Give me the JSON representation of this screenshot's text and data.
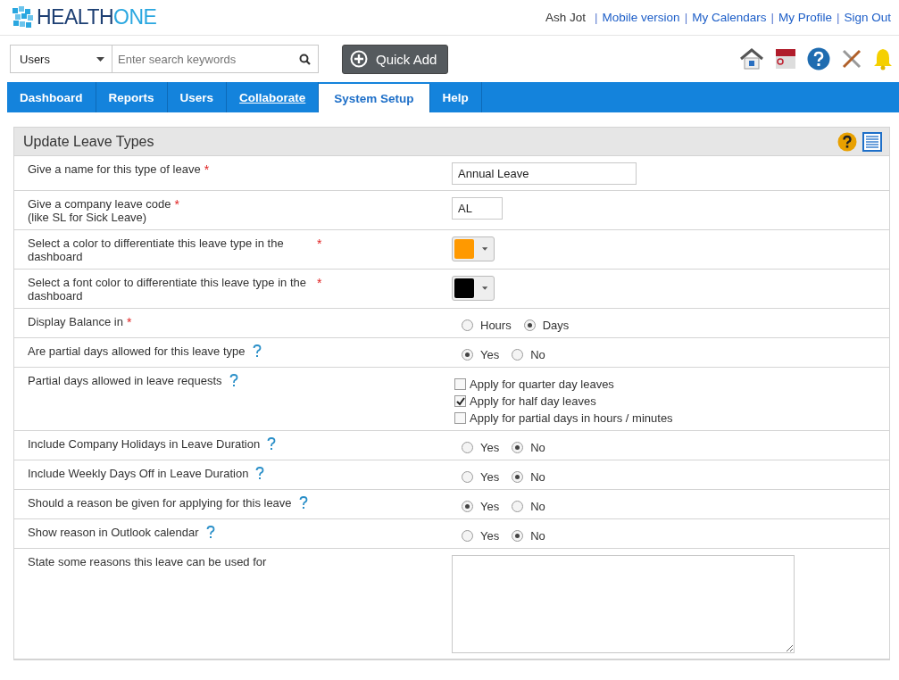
{
  "logo": {
    "parts": [
      "HEALTH",
      "ONE"
    ]
  },
  "user": {
    "name": "Ash Jot",
    "separator": "|",
    "links": [
      "Mobile version",
      "My Calendars",
      "My Profile",
      "Sign Out"
    ]
  },
  "search": {
    "category": "Users",
    "placeholder": "Enter search keywords"
  },
  "quick_add": "Quick Add",
  "nav": [
    {
      "label": "Dashboard",
      "selected": false,
      "underlined": false
    },
    {
      "label": "Reports",
      "selected": false,
      "underlined": false
    },
    {
      "label": "Users",
      "selected": false,
      "underlined": false
    },
    {
      "label": "Collaborate",
      "selected": false,
      "underlined": true
    },
    {
      "label": "System Setup",
      "selected": true,
      "underlined": false
    },
    {
      "label": "Help",
      "selected": false,
      "underlined": false
    }
  ],
  "panel": {
    "title": "Update Leave Types",
    "required_mark": "*",
    "rows": [
      {
        "kind": "text",
        "label": "Give a name for this type of leave",
        "required": true,
        "help": false,
        "value": "Annual Leave",
        "wide": true
      },
      {
        "kind": "text",
        "label": "Give a company leave code\n(like SL for Sick Leave)",
        "required": true,
        "help": false,
        "value": "AL",
        "wide": false
      },
      {
        "kind": "color",
        "label": "Select a color to differentiate this leave type in the dashboard",
        "required": true,
        "help": false,
        "color": "#ff9900"
      },
      {
        "kind": "color",
        "label": "Select a font color to differentiate this leave type in the dashboard",
        "required": true,
        "help": false,
        "color": "#000000"
      },
      {
        "kind": "radio",
        "label": "Display Balance in",
        "required": true,
        "help": false,
        "options": [
          {
            "label": "Hours",
            "selected": false
          },
          {
            "label": "Days",
            "selected": true
          }
        ]
      },
      {
        "kind": "radio",
        "label": "Are partial days allowed for this leave type",
        "required": false,
        "help": true,
        "options": [
          {
            "label": "Yes",
            "selected": true
          },
          {
            "label": "No",
            "selected": false
          }
        ]
      },
      {
        "kind": "checks",
        "label": "Partial days allowed in leave requests",
        "required": false,
        "help": true,
        "options": [
          {
            "label": "Apply for quarter day leaves",
            "checked": false
          },
          {
            "label": "Apply for half day leaves",
            "checked": true
          },
          {
            "label": "Apply for partial days in hours / minutes",
            "checked": false
          }
        ]
      },
      {
        "kind": "radio",
        "label": "Include Company Holidays in Leave Duration",
        "required": false,
        "help": true,
        "options": [
          {
            "label": "Yes",
            "selected": false
          },
          {
            "label": "No",
            "selected": true
          }
        ]
      },
      {
        "kind": "radio",
        "label": "Include Weekly Days Off in Leave Duration",
        "required": false,
        "help": true,
        "options": [
          {
            "label": "Yes",
            "selected": false
          },
          {
            "label": "No",
            "selected": true
          }
        ]
      },
      {
        "kind": "radio",
        "label": "Should a reason be given for applying for this leave",
        "required": false,
        "help": true,
        "options": [
          {
            "label": "Yes",
            "selected": true
          },
          {
            "label": "No",
            "selected": false
          }
        ]
      },
      {
        "kind": "radio",
        "label": "Show reason in Outlook calendar",
        "required": false,
        "help": true,
        "options": [
          {
            "label": "Yes",
            "selected": false
          },
          {
            "label": "No",
            "selected": true
          }
        ]
      },
      {
        "kind": "textarea",
        "label": "State some reasons this leave can be used for",
        "required": false,
        "help": false
      }
    ]
  }
}
